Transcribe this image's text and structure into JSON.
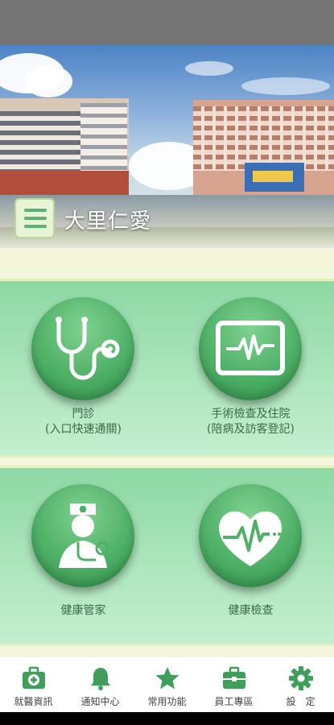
{
  "app": {
    "title": "大里仁愛"
  },
  "tiles": [
    {
      "label_line1": "門診",
      "label_line2": "(入口快速通關)",
      "icon": "stethoscope-icon"
    },
    {
      "label_line1": "手術檢查及住院",
      "label_line2": "(陪病及訪客登記)",
      "icon": "monitor-heartbeat-icon"
    },
    {
      "label_line1": "健康管家",
      "label_line2": "",
      "icon": "nurse-icon"
    },
    {
      "label_line1": "健康檢查",
      "label_line2": "",
      "icon": "heart-pulse-icon"
    }
  ],
  "tabbar": [
    {
      "label": "就醫資訊",
      "icon": "medical-kit-icon"
    },
    {
      "label": "通知中心",
      "icon": "bell-icon"
    },
    {
      "label": "常用功能",
      "icon": "star-icon"
    },
    {
      "label": "員工專區",
      "icon": "briefcase-icon"
    },
    {
      "label": "設　定",
      "icon": "gear-icon"
    }
  ],
  "colors": {
    "accent": "#4fb067",
    "tab_icon": "#3f9e5a",
    "panel": "#a7e3b8"
  }
}
